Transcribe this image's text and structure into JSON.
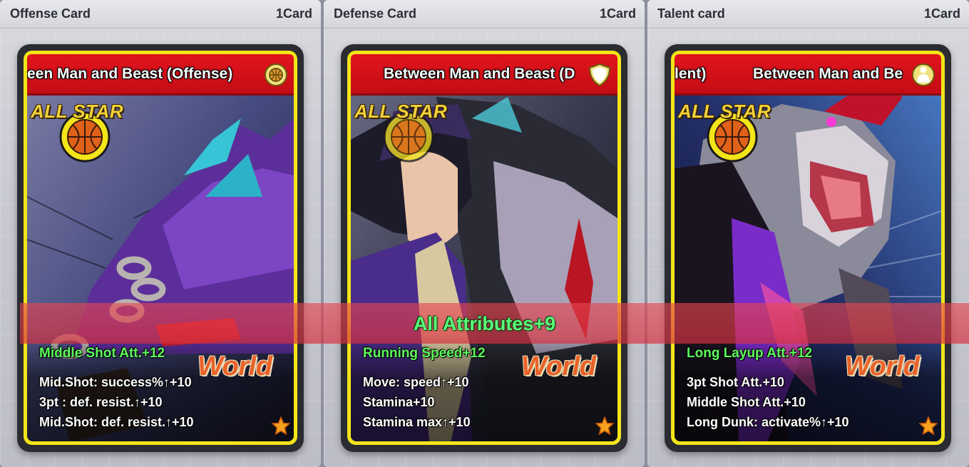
{
  "columns": [
    {
      "header_title": "Offense Card",
      "header_count": "1Card",
      "card_title": "een Man and Beast (Offense)",
      "badge": "ALL STAR",
      "world": "World",
      "main_stat": "Middle Shot Att.+12",
      "sub_stats": [
        "Mid.Shot: success%↑+10",
        "3pt : def. resist.↑+10",
        "Mid.Shot: def. resist.↑+10"
      ],
      "icon": "basketball-icon"
    },
    {
      "header_title": "Defense Card",
      "header_count": "1Card",
      "card_title": "Between Man and Beast (D",
      "badge": "ALL STAR",
      "world": "World",
      "main_stat": "Running Speed+12",
      "sub_stats": [
        "Move: speed↑+10",
        "Stamina+10",
        "Stamina max↑+10"
      ],
      "icon": "shield-icon"
    },
    {
      "header_title": "Talent card",
      "header_count": "1Card",
      "card_title_left": "lent)",
      "card_title": "Between Man and Be",
      "badge": "ALL STAR",
      "world": "World",
      "main_stat": "Long Layup Att.+12",
      "sub_stats": [
        "3pt Shot Att.+10",
        "Middle Shot Att.+10",
        "Long Dunk: activate%↑+10"
      ],
      "icon": "player-icon"
    }
  ],
  "banner": {
    "text": "All Attributes+9"
  },
  "colors": {
    "title_red": "#d8101a",
    "card_yellow": "#f4e51a",
    "stat_green": "#5dff5d"
  }
}
